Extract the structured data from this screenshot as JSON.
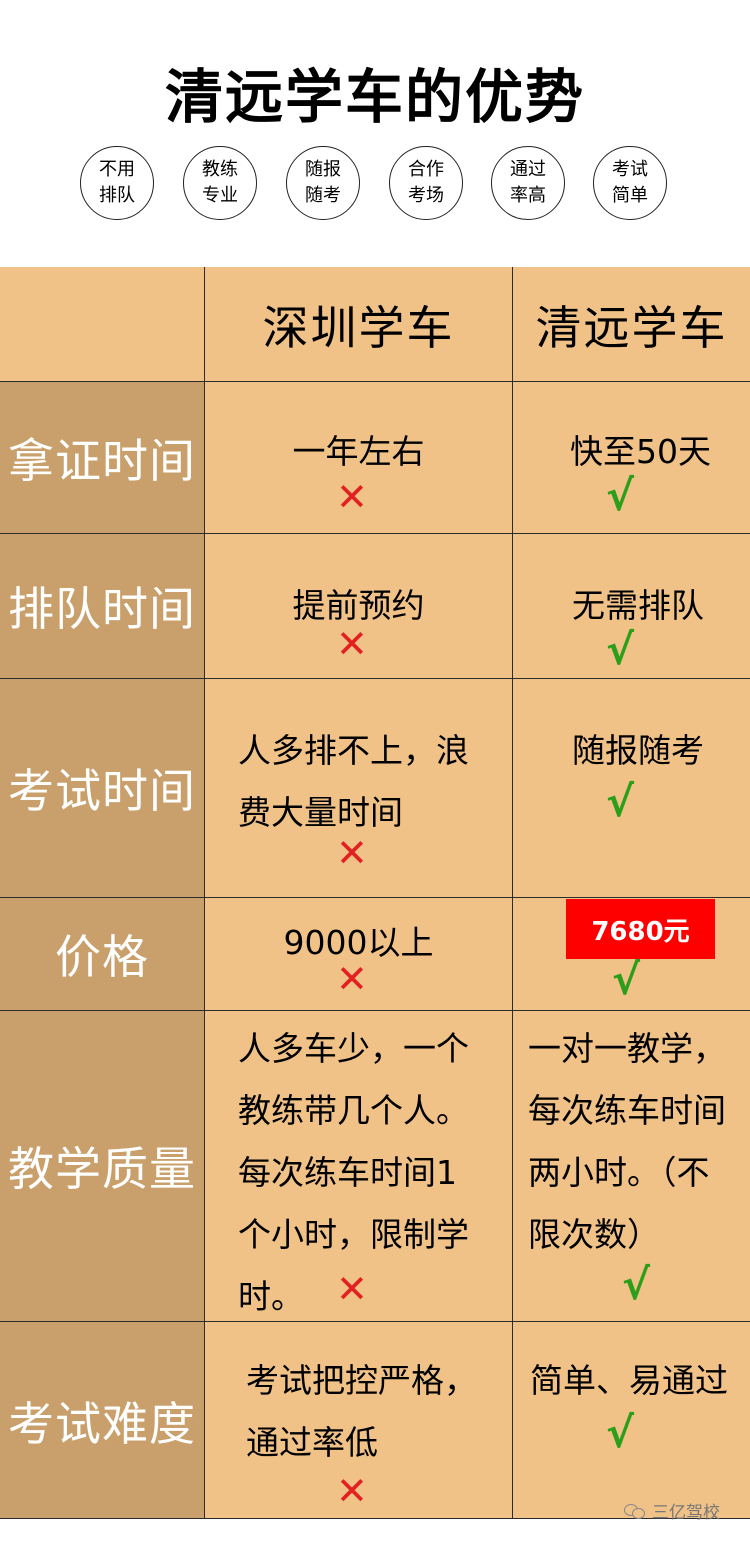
{
  "title": "清远学车的优势",
  "badges": [
    {
      "line1": "不用",
      "line2": "排队"
    },
    {
      "line1": "教练",
      "line2": "专业"
    },
    {
      "line1": "随报",
      "line2": "随考"
    },
    {
      "line1": "合作",
      "line2": "考场"
    },
    {
      "line1": "通过",
      "line2": "率高"
    },
    {
      "line1": "考试",
      "line2": "简单"
    }
  ],
  "table": {
    "columns": [
      "深圳学车",
      "清远学车"
    ],
    "rows": [
      {
        "label": "拿证时间",
        "shenzhen": "一年左右",
        "qingyuan": "快至50天"
      },
      {
        "label": "排队时间",
        "shenzhen": "提前预约",
        "qingyuan": "无需排队"
      },
      {
        "label": "考试时间",
        "shenzhen": [
          "人多排不上，浪",
          "费大量时间"
        ],
        "qingyuan": "随报随考"
      },
      {
        "label": "价格",
        "shenzhen": "9000以上",
        "qingyuan": "7680元"
      },
      {
        "label": "教学质量",
        "shenzhen": [
          "人多车少，一个",
          "教练带几个人。",
          "每次练车时间1",
          "个小时，限制学",
          "时。"
        ],
        "qingyuan": [
          "一对一教学，",
          "每次练车时间",
          "两小时。（不",
          "限次数）"
        ]
      },
      {
        "label": "考试难度",
        "shenzhen": [
          "考试把控严格，",
          "通过率低"
        ],
        "qingyuan": "简单、易通过"
      }
    ],
    "bad_mark": "✕",
    "good_mark": "√"
  },
  "watermark": "三亿驾校",
  "colors": {
    "table_bg": "#f0c287",
    "row_header_bg": "#c9a06b",
    "price_tag": "#ff0000",
    "bad": "#e32020",
    "good": "#2c9e1a"
  }
}
